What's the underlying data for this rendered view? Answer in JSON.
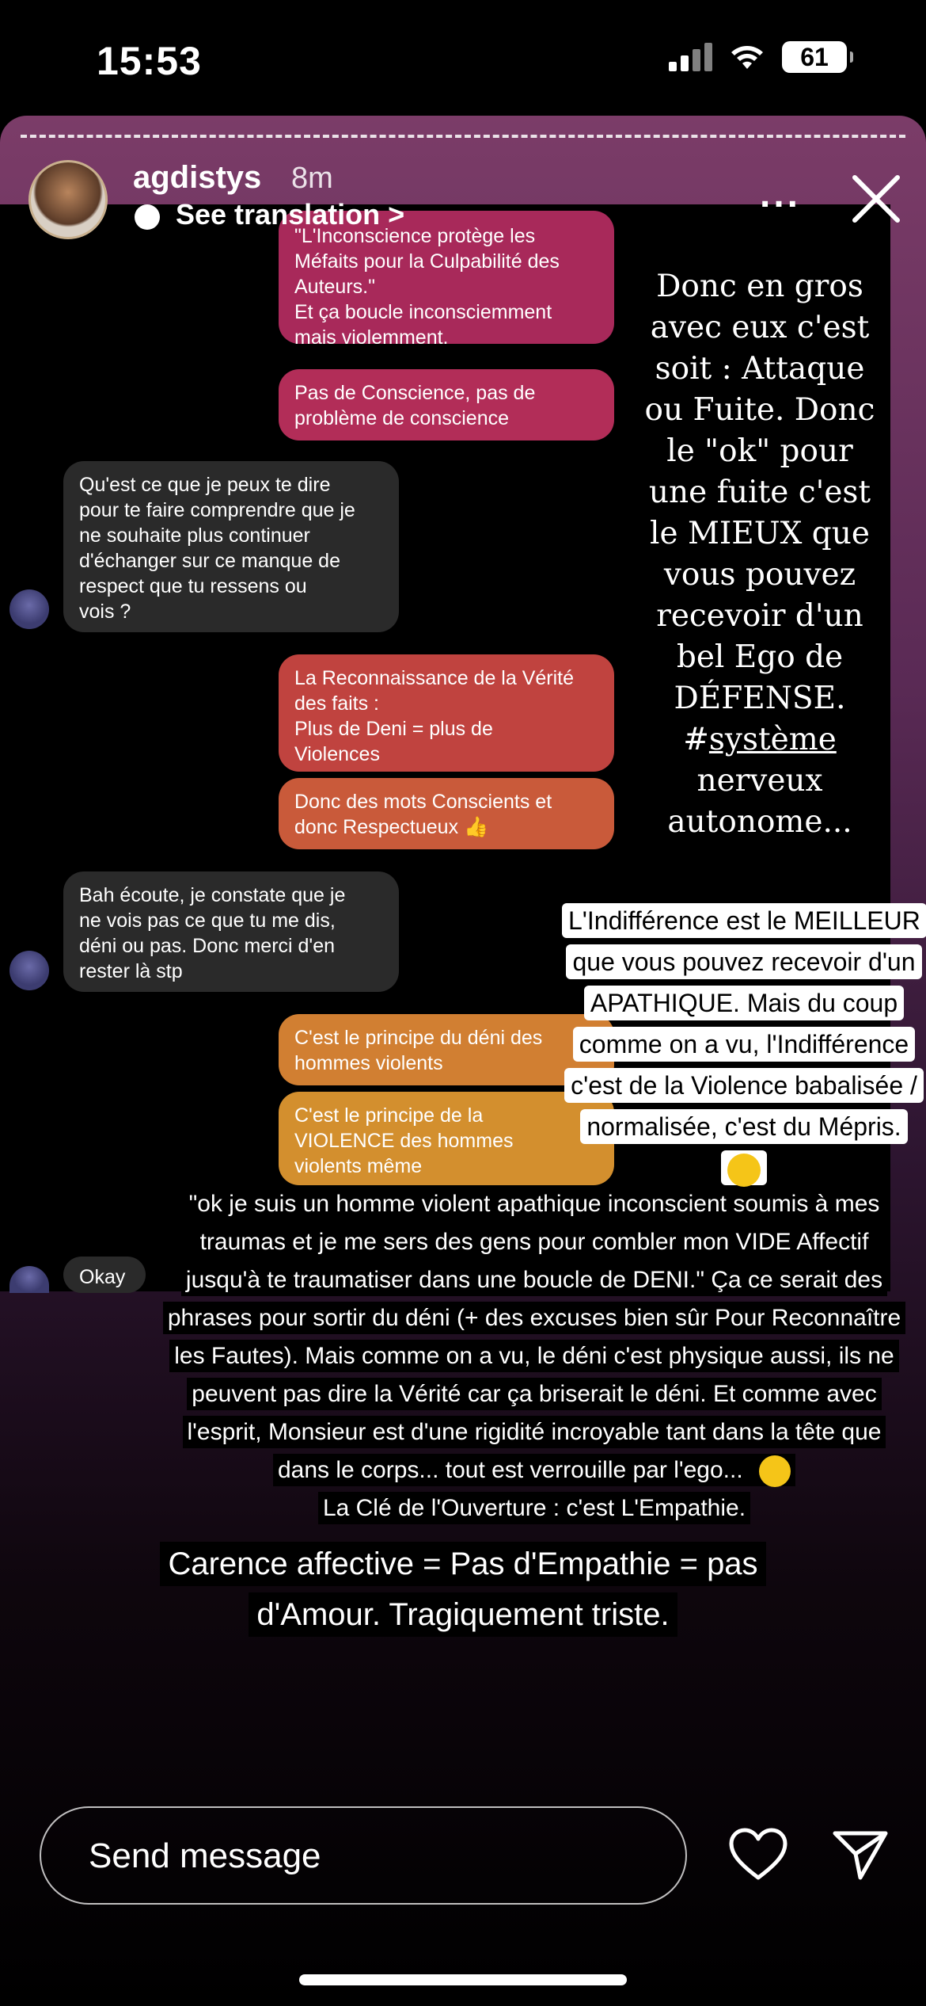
{
  "status_bar": {
    "time": "15:53",
    "battery": "61"
  },
  "story": {
    "username": "agdistys",
    "time_ago": "8m",
    "see_translation": "See translation >"
  },
  "chat": {
    "out1": "\"L'Inconscience protège les\nMéfaits pour la Culpabilité des\nAuteurs.\"\nEt ça boucle inconsciemment\nmais violemment.",
    "out2": "Pas de Conscience, pas de\nproblème de conscience",
    "in1": "Qu'est ce que je peux te dire\npour te faire comprendre que je\nne souhaite plus continuer\nd'échanger sur ce manque de\nrespect que tu ressens ou\nvois ?",
    "out3": "La Reconnaissance de la Vérité\ndes faits :\nPlus de Deni = plus de\nViolences",
    "out4": "Donc des mots Conscients et\ndonc Respectueux 👍",
    "in2": "Bah écoute, je constate que je\nne vois pas ce que tu me dis,\ndéni ou pas. Donc merci d'en\nrester là stp",
    "out5": "C'est le principe du déni des\nhommes violents",
    "out6": "C'est le principe de la\nVIOLENCE des hommes\nviolents même",
    "in3": "Okay"
  },
  "overlay": {
    "serif_text_1": "Donc en gros avec eux c'est soit : Attaque ou Fuite. Donc le \"ok\" pour une fuite c'est le MIEUX que vous pouvez recevoir d'un bel Ego de DÉFENSE. #",
    "serif_hashtag": "système",
    "serif_text_2": " nerveux autonome...",
    "highlight_text": "L'Indifférence est le MEILLEUR que vous pouvez recevoir d'un APATHIQUE. Mais du coup comme on a vu, l'Indifférence c'est de la Violence babalisée / normalisée, c'est du Mépris.",
    "paragraph": "\"ok je suis un homme violent apathique inconscient soumis à mes traumas et je me sers des gens pour combler mon VIDE Affectif jusqu'à te traumatiser dans une boucle de DENI.\" Ça ce serait des phrases pour sortir du déni (+ des excuses bien sûr Pour Reconnaître les Fautes). Mais comme on a vu, le déni c'est physique aussi, ils ne peuvent pas dire la Vérité car ça briserait le déni. Et comme avec l'esprit, Monsieur est d'une rigidité incroyable tant dans la tête que dans le corps... tout est verrouille par l'ego... ",
    "paragraph_end": "La Clé de l'Ouverture : c'est L'Empathie.",
    "tagline": "Carence affective = Pas d'Empathie = pas d'Amour. Tragiquement triste."
  },
  "bottom": {
    "placeholder": "Send message"
  }
}
